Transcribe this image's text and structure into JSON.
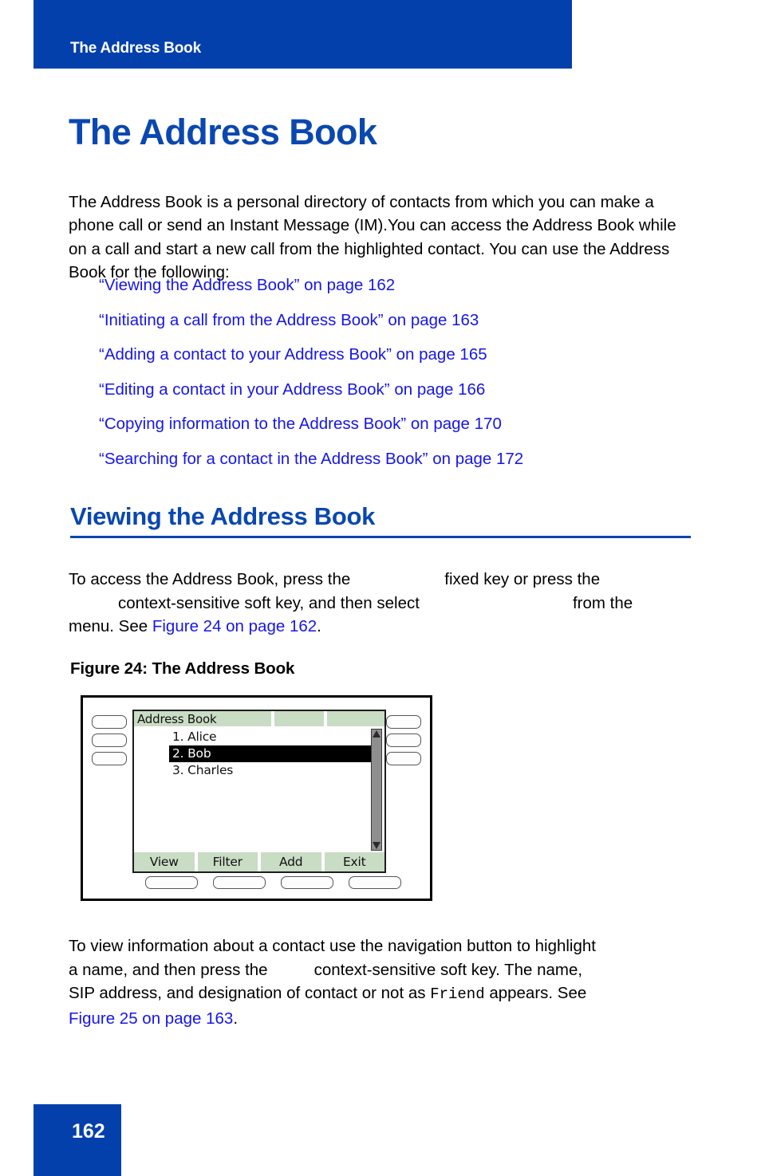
{
  "header": {
    "running_title": "The Address Book"
  },
  "chapter": {
    "title": "The Address Book"
  },
  "intro": {
    "paragraph": "The Address Book is a personal directory of contacts from which you can make a phone call or send an Instant Message (IM).You can access the Address Book while on a call and start a new call from the highlighted contact. You can use the Address Book for the following:"
  },
  "xrefs": [
    {
      "text": "“Viewing the Address Book” on page 162"
    },
    {
      "text": "“Initiating a call from the Address Book” on page 163"
    },
    {
      "text": "“Adding a contact to your Address Book” on page 165"
    },
    {
      "text": "“Editing a contact in your Address Book” on page 166"
    },
    {
      "text": "“Copying information to the Address Book” on page 170"
    },
    {
      "text": "“Searching for a contact in the Address Book” on page 172"
    }
  ],
  "section": {
    "heading": "Viewing the Address Book"
  },
  "access_para": {
    "line1_a": "To access the Address Book, press the",
    "line1_b": "fixed key or press the",
    "line2_a": "context-sensitive soft key, and then select",
    "line2_b": "from the",
    "line3_a": "menu. See",
    "line3_link": "Figure 24 on page 162",
    "line3_b": "."
  },
  "figure": {
    "caption": "Figure 24:  The Address Book",
    "screen": {
      "title": "Address Book",
      "contacts": [
        {
          "label": "1. Alice",
          "selected": false
        },
        {
          "label": "2. Bob",
          "selected": true
        },
        {
          "label": "3. Charles",
          "selected": false
        }
      ],
      "softkeys": [
        {
          "label": "View"
        },
        {
          "label": "Filter"
        },
        {
          "label": "Add"
        },
        {
          "label": "Exit"
        }
      ]
    },
    "colors": {
      "lcd_green": "#c9dcc4",
      "selection": "#000000"
    }
  },
  "close_para": {
    "line1": "To view information about a contact use the navigation button to highlight",
    "line2_a": "a name, and then press the",
    "line2_b": "context-sensitive soft key. The name,",
    "line3_a": "SIP address, and designation of contact or not as",
    "line3_mono": "Friend",
    "line3_b": "appears. See",
    "line4_link": "Figure 25 on page 163",
    "line4_b": "."
  },
  "footer": {
    "page_number": "162"
  },
  "colors": {
    "brand_blue": "#0340ac",
    "heading_blue": "#0a47b0",
    "link_blue": "#1616e8"
  }
}
